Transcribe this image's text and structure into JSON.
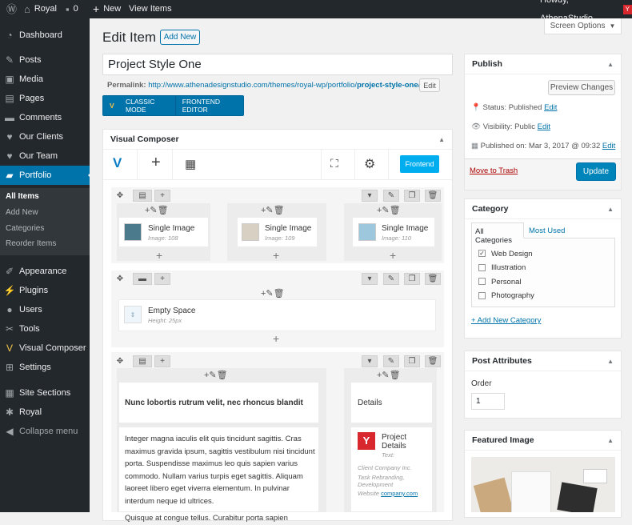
{
  "admin_bar": {
    "site_name": "Royal",
    "comments_count": "0",
    "new_label": "New",
    "view_items_label": "View Items",
    "greeting": "Howdy, AthenaStudio"
  },
  "sidebar": {
    "items": [
      {
        "label": "Dashboard",
        "icon": "dashboard-icon"
      },
      {
        "label": "Posts",
        "icon": "pin-icon"
      },
      {
        "label": "Media",
        "icon": "media-icon"
      },
      {
        "label": "Pages",
        "icon": "page-icon"
      },
      {
        "label": "Comments",
        "icon": "comment-icon"
      },
      {
        "label": "Our Clients",
        "icon": "heart-icon"
      },
      {
        "label": "Our Team",
        "icon": "heart-icon"
      },
      {
        "label": "Portfolio",
        "icon": "folder-icon"
      },
      {
        "label": "Appearance",
        "icon": "brush-icon"
      },
      {
        "label": "Plugins",
        "icon": "plug-icon"
      },
      {
        "label": "Users",
        "icon": "user-icon"
      },
      {
        "label": "Tools",
        "icon": "wrench-icon"
      },
      {
        "label": "Visual Composer",
        "icon": "vc-icon"
      },
      {
        "label": "Settings",
        "icon": "settings-icon"
      },
      {
        "label": "Site Sections",
        "icon": "grid-icon"
      },
      {
        "label": "Royal",
        "icon": "gear-icon"
      },
      {
        "label": "Collapse menu",
        "icon": "collapse-icon"
      }
    ],
    "submenu": [
      "All Items",
      "Add New",
      "Categories",
      "Reorder Items"
    ]
  },
  "page": {
    "title": "Edit Item",
    "add_new_label": "Add New",
    "screen_options_label": "Screen Options"
  },
  "post": {
    "title": "Project Style One",
    "permalink_label": "Permalink:",
    "permalink_base": "http://www.athenadesignstudio.com/themes/royal-wp/portfolio/",
    "permalink_slug": "project-style-one",
    "permalink_end": "/",
    "edit_label": "Edit"
  },
  "vc_buttons": {
    "classic": "CLASSIC MODE",
    "frontend": "FRONTEND EDITOR"
  },
  "visual_composer": {
    "title": "Visual Composer",
    "frontend_button": "Frontend",
    "row1": [
      {
        "title": "Single Image",
        "sub": "Image: 108"
      },
      {
        "title": "Single Image",
        "sub": "Image: 109"
      },
      {
        "title": "Single Image",
        "sub": "Image: 110"
      }
    ],
    "row2": {
      "title": "Empty Space",
      "sub": "Height: 25px"
    },
    "row3": {
      "heading": "Nunc lobortis rutrum velit, nec rhoncus blandit",
      "details_heading": "Details",
      "paragraph": [
        "Integer magna iaculis elit quis tincidunt sagittis. Cras",
        "maximus gravida ipsum, sagittis vestibulum nisi tincidunt",
        "porta. Suspendisse maximus leo quis sapien varius",
        "commodo. Nullam varius turpis eget sagittis. Aliquam",
        "laoreet libero eget viverra elementum. In pulvinar",
        "interdum neque id ultrices.",
        "Quisque at congue tellus. Curabitur porta sapien"
      ],
      "project_details": {
        "title1": "Project",
        "title2": "Details",
        "text_label": "Text:",
        "client": "Client Company Inc.",
        "task1": "Task Rebranding,",
        "task2": "Development",
        "website_label": "Website",
        "website_link": "company.com"
      }
    }
  },
  "publish": {
    "title": "Publish",
    "preview_label": "Preview Changes",
    "status_label": "Status: Published",
    "status_edit": "Edit",
    "visibility_label": "Visibility: Public",
    "visibility_edit": "Edit",
    "published_label": "Published on: Mar 3, 2017 @ 09:32",
    "published_edit": "Edit",
    "trash_label": "Move to Trash",
    "update_label": "Update"
  },
  "category": {
    "title": "Category",
    "tab_all": "All Categories",
    "tab_most_used": "Most Used",
    "items": [
      {
        "label": "Web Design",
        "checked": true
      },
      {
        "label": "Illustration",
        "checked": false
      },
      {
        "label": "Personal",
        "checked": false
      },
      {
        "label": "Photography",
        "checked": false
      }
    ],
    "add_new": "+ Add New Category"
  },
  "post_attributes": {
    "title": "Post Attributes",
    "order_label": "Order",
    "order_value": "1"
  },
  "featured_image": {
    "title": "Featured Image"
  },
  "colors": {
    "accent": "#0073aa",
    "admin_bar": "#23282d",
    "frontend_blue": "#00aef0"
  }
}
